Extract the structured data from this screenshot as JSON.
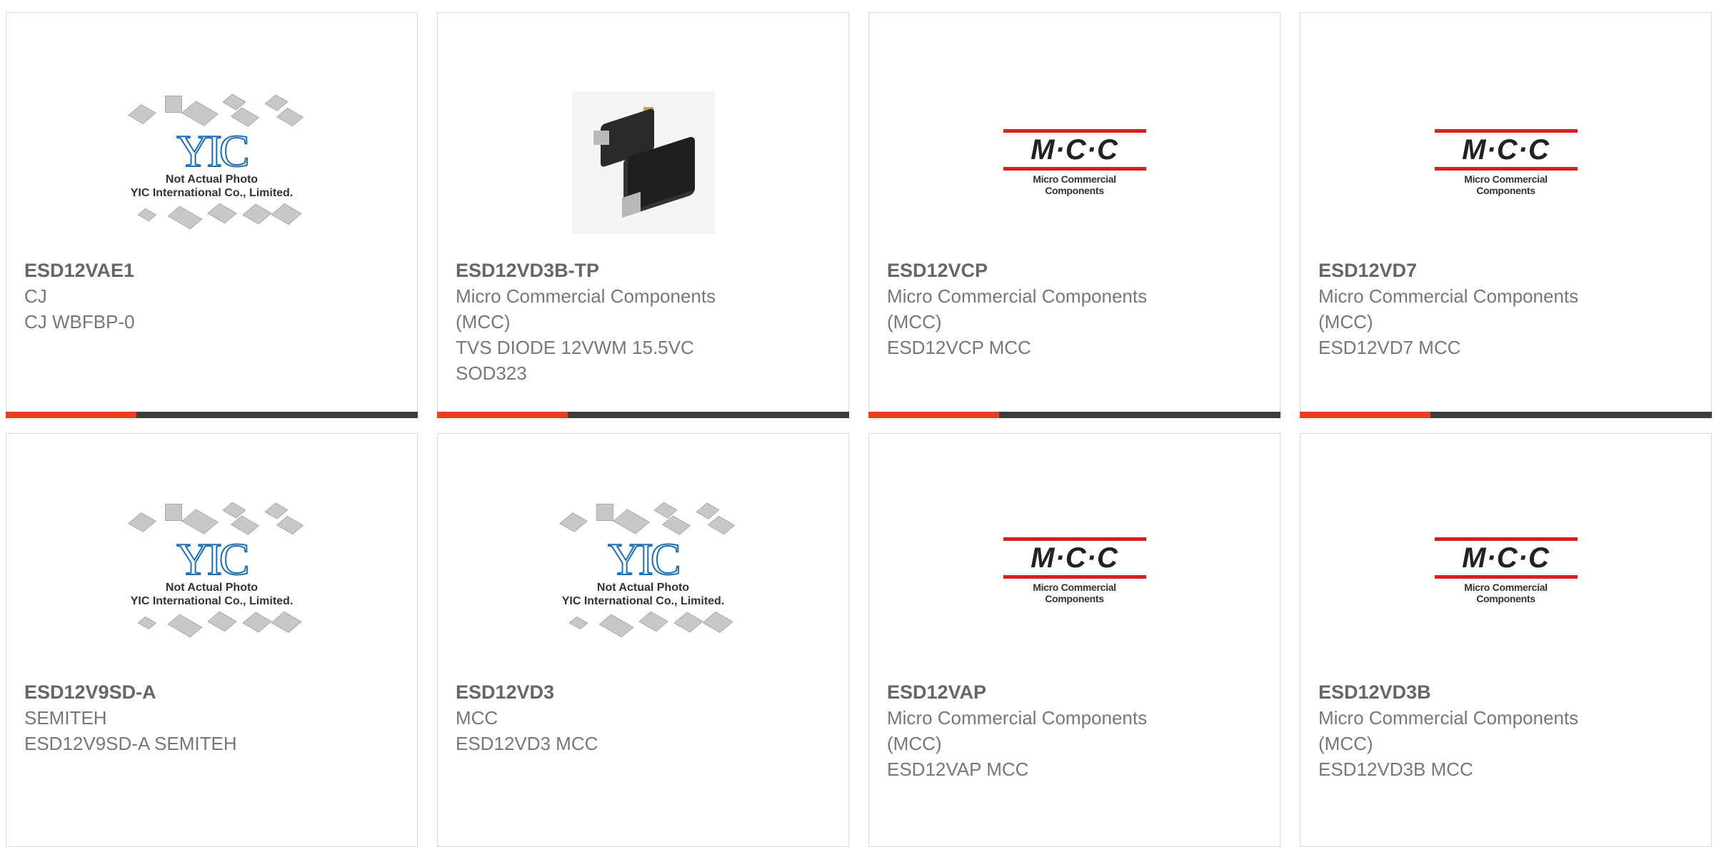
{
  "colors": {
    "accent": "#e8401c",
    "bar": "#3d3d3d",
    "mcc_red": "#d62020",
    "yic_blue": "#1b6fb6"
  },
  "products": [
    {
      "part": "ESD12VAE1",
      "lines": [
        "CJ",
        "CJ WBFBP-0"
      ],
      "image": "yic-placeholder"
    },
    {
      "part": "ESD12VD3B-TP",
      "lines": [
        "Micro Commercial Components",
        "(MCC)",
        "TVS DIODE 12VWM 15.5VC",
        "SOD323"
      ],
      "image": "diode-photo"
    },
    {
      "part": "ESD12VCP",
      "lines": [
        "Micro Commercial Components",
        "(MCC)",
        "ESD12VCP MCC"
      ],
      "image": "mcc-logo"
    },
    {
      "part": "ESD12VD7",
      "lines": [
        "Micro Commercial Components",
        "(MCC)",
        "ESD12VD7 MCC"
      ],
      "image": "mcc-logo"
    },
    {
      "part": "ESD12V9SD-A",
      "lines": [
        "SEMITEH",
        "ESD12V9SD-A SEMITEH"
      ],
      "image": "yic-placeholder"
    },
    {
      "part": "ESD12VD3",
      "lines": [
        "MCC",
        "ESD12VD3 MCC"
      ],
      "image": "yic-placeholder"
    },
    {
      "part": "ESD12VAP",
      "lines": [
        "Micro Commercial Components",
        "(MCC)",
        "ESD12VAP MCC"
      ],
      "image": "mcc-logo"
    },
    {
      "part": "ESD12VD3B",
      "lines": [
        "Micro Commercial Components",
        "(MCC)",
        "ESD12VD3B MCC"
      ],
      "image": "mcc-logo"
    }
  ],
  "yic": {
    "logo": "YIC",
    "caption1": "Not Actual Photo",
    "caption2": "YIC International Co., Limited."
  },
  "mcc": {
    "letters": "M·C·C",
    "tagline": "Micro Commercial Components"
  }
}
